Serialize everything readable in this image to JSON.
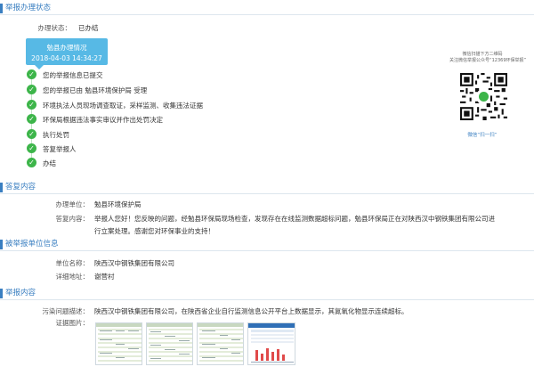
{
  "status_section": {
    "title": "举报办理状态",
    "status_label": "办理状态：",
    "status_value": "已办结",
    "badge_title": "勉县办理情况",
    "badge_time": "2018-04-03 14:34:27",
    "steps": [
      "您的举报信息已提交",
      "您的举报已由 勉县环境保护局 受理",
      "环境执法人员现场调查取证，采样监测、收集违法证据",
      "环保局根据违法事实审议并作出处罚决定",
      "执行处罚",
      "答复举报人",
      "办结"
    ],
    "qr_note_1": "微信扫描下方二维码",
    "qr_note_2": "关注微信举报公众号“12369环保举报”",
    "qr_scan": "微信“扫一扫”"
  },
  "reply_section": {
    "title": "答复内容",
    "unit_label": "办理单位：",
    "unit_value": "勉县环境保护局",
    "content_label": "答复内容：",
    "content_value_1": "举报人您好！您反映的问题，经勉县环保局现场检查，发现存在在线监测数据超标问题，勉县环保局正在对陕西汉中钢铁集团有限公司进",
    "content_value_2": "行立案处理。感谢您对环保事业的支持！"
  },
  "reported_section": {
    "title": "被举报单位信息",
    "name_label": "单位名称：",
    "name_value": "陕西汉中钢铁集团有限公司",
    "address_label": "详细地址：",
    "address_value": "谢营村"
  },
  "report_section": {
    "title": "举报内容",
    "desc_label": "污染问题描述：",
    "desc_value": "陕西汉中钢铁集团有限公司，在陕西省企业自行监测信息公开平台上数据显示，其氮氧化物显示连续超标。",
    "evidence_label": "证据图片："
  },
  "colors": {
    "accent": "#3a7fc1",
    "badge": "#57b9e5",
    "check": "#3db54a"
  }
}
